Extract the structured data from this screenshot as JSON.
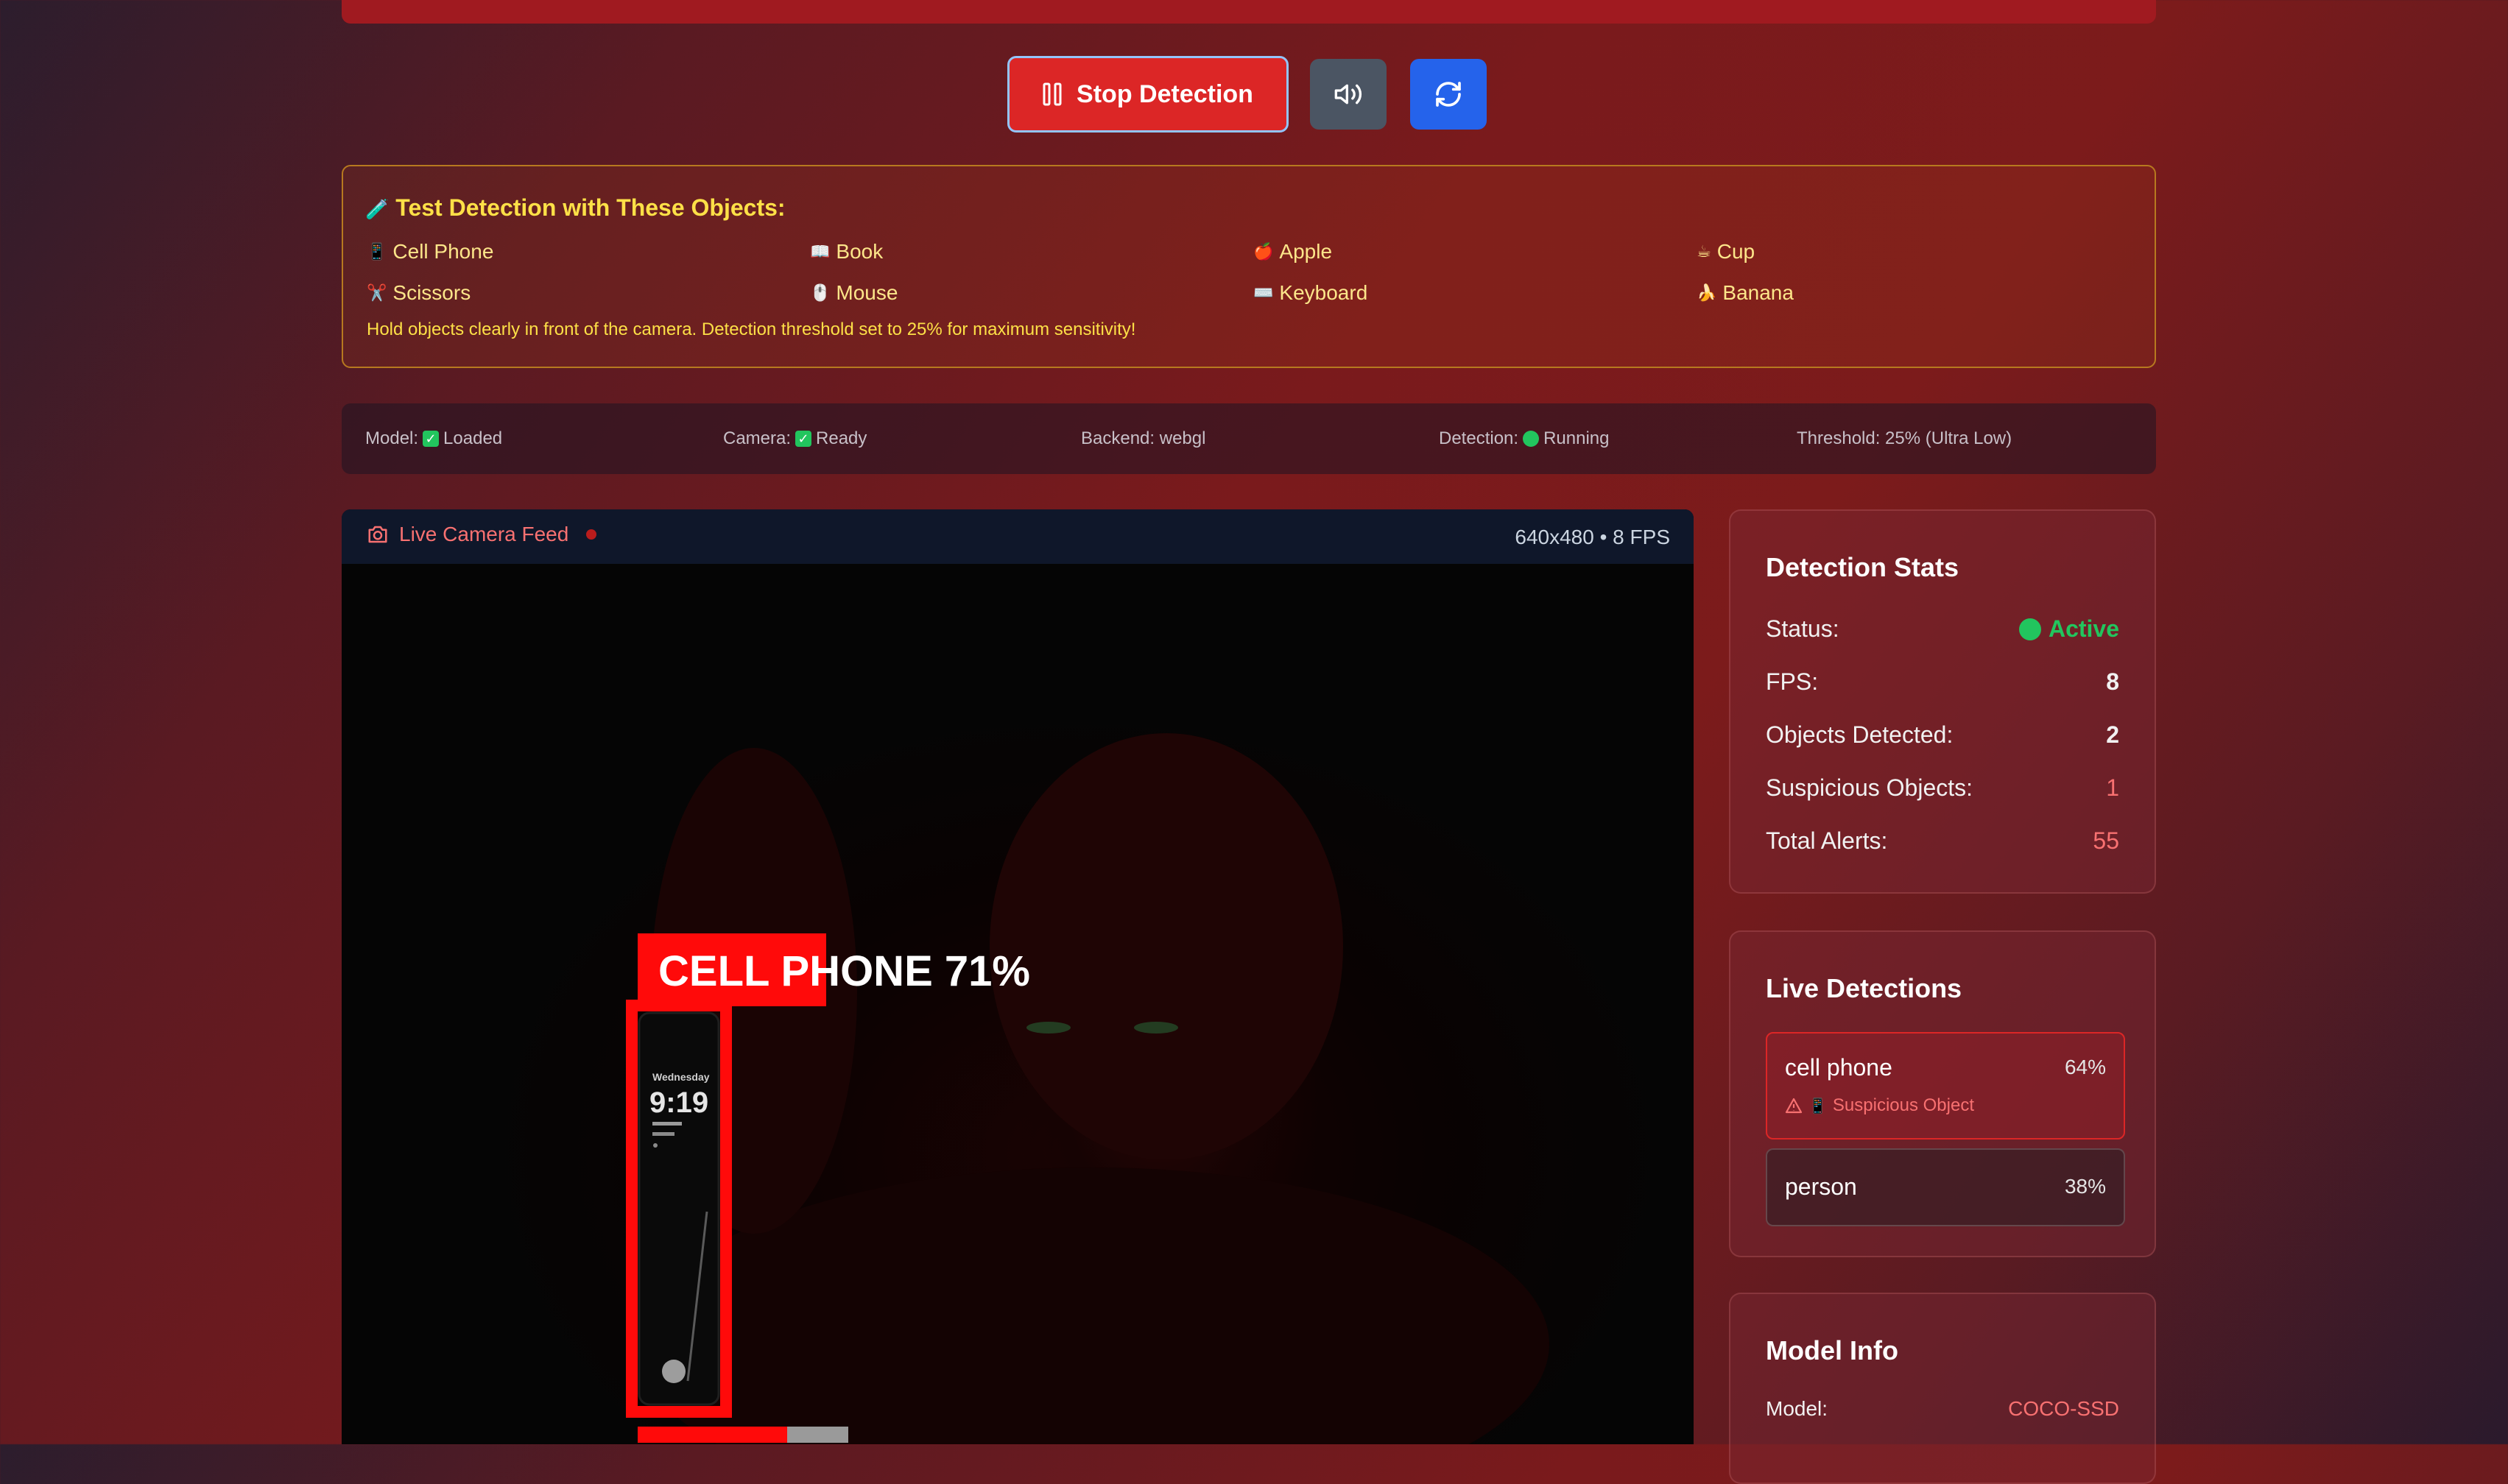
{
  "controls": {
    "stop_label": "Stop Detection",
    "colors": {
      "stop": "#dc2626",
      "sound": "#4b5563",
      "refresh": "#2563eb"
    }
  },
  "test_objects": {
    "title": "Test Detection with These Objects:",
    "items": [
      {
        "emoji": "📱",
        "label": "Cell Phone"
      },
      {
        "emoji": "📖",
        "label": "Book"
      },
      {
        "emoji": "🍎",
        "label": "Apple"
      },
      {
        "emoji": "☕",
        "label": "Cup"
      },
      {
        "emoji": "✂️",
        "label": "Scissors"
      },
      {
        "emoji": "🖱️",
        "label": "Mouse"
      },
      {
        "emoji": "⌨️",
        "label": "Keyboard"
      },
      {
        "emoji": "🍌",
        "label": "Banana"
      }
    ],
    "note": "Hold objects clearly in front of the camera. Detection threshold set to 25% for maximum sensitivity!"
  },
  "status_bar": {
    "model_label": "Model:",
    "model_value": "Loaded",
    "camera_label": "Camera:",
    "camera_value": "Ready",
    "backend": "Backend: webgl",
    "detection_label": "Detection:",
    "detection_value": "Running",
    "threshold": "Threshold: 25% (Ultra Low)"
  },
  "camera": {
    "title": "Live Camera Feed",
    "info": "640x480 • 8 FPS",
    "detection_label": "CELL PHONE 71%",
    "phone_screen": {
      "day": "Wednesday",
      "time": "9:19"
    },
    "confidence_bar": 0.71
  },
  "stats": {
    "title": "Detection Stats",
    "status_label": "Status:",
    "status_value": "Active",
    "fps_label": "FPS:",
    "fps_value": "8",
    "objects_label": "Objects Detected:",
    "objects_value": "2",
    "suspicious_label": "Suspicious Objects:",
    "suspicious_value": "1",
    "alerts_label": "Total Alerts:",
    "alerts_value": "55"
  },
  "live_detections": {
    "title": "Live Detections",
    "items": [
      {
        "name": "cell phone",
        "confidence": "64%",
        "warning": "Suspicious Object"
      },
      {
        "name": "person",
        "confidence": "38%"
      }
    ]
  },
  "model_info": {
    "title": "Model Info",
    "model_label": "Model:",
    "model_value": "COCO-SSD"
  }
}
